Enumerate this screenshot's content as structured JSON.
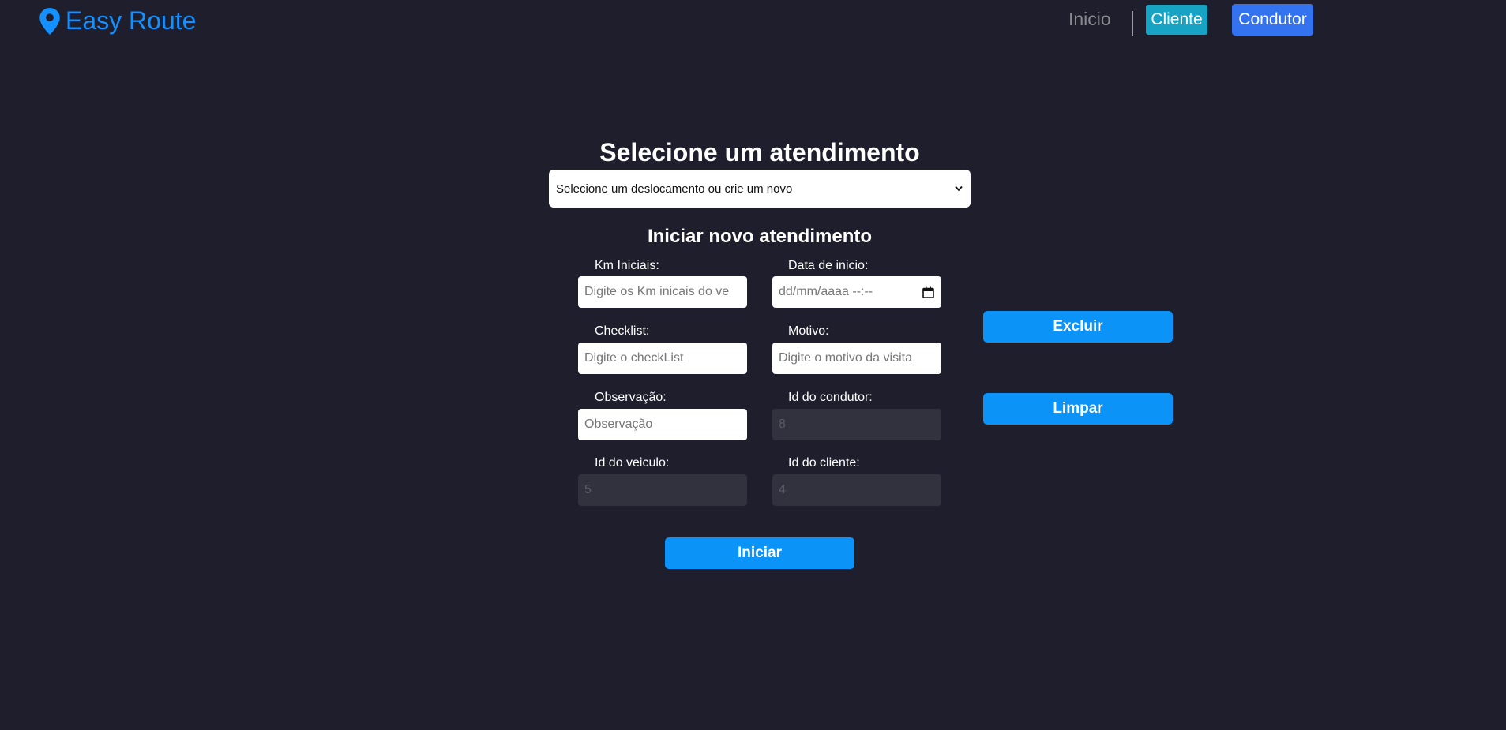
{
  "header": {
    "logo_text": "Easy Route",
    "logo_icon": "map-pin-icon",
    "nav_inicio": "Inicio",
    "nav_cliente": "Cliente",
    "nav_condutor": "Condutor"
  },
  "main": {
    "title": "Selecione um atendimento",
    "select_value": "Selecione um deslocamento ou crie um novo",
    "subtitle": "Iniciar novo atendimento"
  },
  "form": {
    "km_label": "Km Iniciais:",
    "km_placeholder": "Digite os Km inicais do ve",
    "data_label": "Data de inicio:",
    "data_placeholder": "dd/mm/aaaa --:--",
    "checklist_label": "Checklist:",
    "checklist_placeholder": "Digite o checkList",
    "motivo_label": "Motivo:",
    "motivo_placeholder": "Digite o motivo da visita",
    "observacao_label": "Observação:",
    "observacao_placeholder": "Observação",
    "condutor_label": "Id do condutor:",
    "condutor_value": "8",
    "veiculo_label": "Id do veiculo:",
    "veiculo_value": "5",
    "cliente_label": "Id do cliente:",
    "cliente_value": "4"
  },
  "actions": {
    "excluir": "Excluir",
    "limpar": "Limpar",
    "iniciar": "Iniciar"
  },
  "colors": {
    "background": "#1e1e2d",
    "accent_blue": "#0b93f7",
    "logo_blue": "#1590ff",
    "cliente_button": "#17a3c3",
    "condutor_button": "#3473f0"
  }
}
